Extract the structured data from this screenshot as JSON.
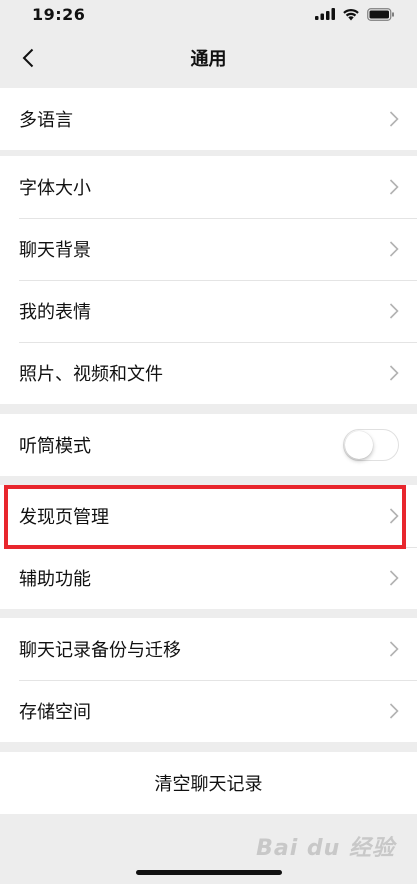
{
  "status_bar": {
    "time": "19:26"
  },
  "nav": {
    "title": "通用"
  },
  "groups": [
    {
      "items": [
        {
          "label": "多语言"
        }
      ]
    },
    {
      "items": [
        {
          "label": "字体大小"
        },
        {
          "label": "聊天背景"
        },
        {
          "label": "我的表情"
        },
        {
          "label": "照片、视频和文件"
        }
      ]
    },
    {
      "items": [
        {
          "label": "听筒模式",
          "toggle_on": false
        }
      ]
    },
    {
      "items": [
        {
          "label": "发现页管理",
          "highlighted": true
        },
        {
          "label": "辅助功能"
        }
      ]
    },
    {
      "items": [
        {
          "label": "聊天记录备份与迁移"
        },
        {
          "label": "存储空间"
        }
      ]
    },
    {
      "items": [
        {
          "label": "清空聊天记录"
        }
      ]
    }
  ],
  "watermark": {
    "text": "Bai du 经验"
  },
  "colors": {
    "background": "#ededed",
    "cell": "#ffffff",
    "highlight": "#e8262d",
    "chevron": "#b2b2b2"
  },
  "icons": [
    "back-chevron-icon",
    "signal-icon",
    "wifi-icon",
    "battery-icon",
    "chevron-right-icon"
  ]
}
